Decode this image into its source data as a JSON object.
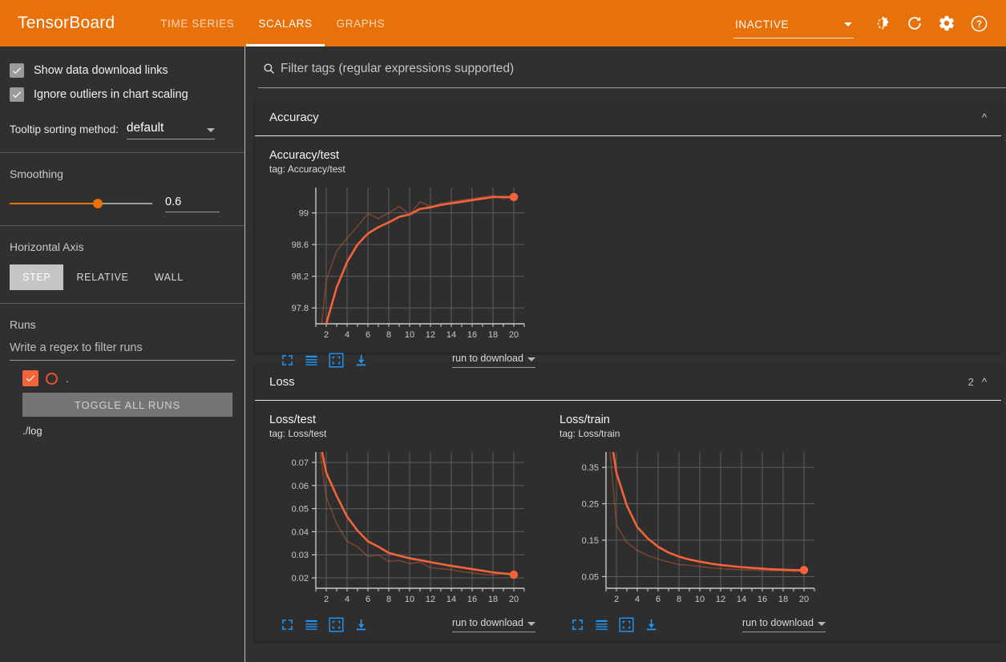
{
  "app": {
    "brand": "TensorBoard",
    "accent_orange": "#e8710a",
    "line_color": "#f4633a",
    "bg": "#303030",
    "card_bg": "#2e2e2e"
  },
  "header": {
    "tabs": [
      {
        "label": "TIME SERIES",
        "active": false
      },
      {
        "label": "SCALARS",
        "active": true
      },
      {
        "label": "GRAPHS",
        "active": false
      }
    ],
    "status": "INACTIVE",
    "icons": [
      {
        "name": "brightness-icon",
        "title": "Toggle dark mode"
      },
      {
        "name": "refresh-icon",
        "title": "Refresh"
      },
      {
        "name": "gear-icon",
        "title": "Settings"
      },
      {
        "name": "help-icon",
        "title": "Help"
      }
    ]
  },
  "sidebar": {
    "checkboxes": [
      {
        "label": "Show data download links",
        "checked": true
      },
      {
        "label": "Ignore outliers in chart scaling",
        "checked": true
      }
    ],
    "tooltip_sorting": {
      "label": "Tooltip sorting method:",
      "value": "default"
    },
    "smoothing": {
      "label": "Smoothing",
      "value": "0.6",
      "fraction": 0.62
    },
    "horizontal_axis": {
      "label": "Horizontal Axis",
      "options": [
        "STEP",
        "RELATIVE",
        "WALL"
      ],
      "selected": "STEP"
    },
    "runs": {
      "label": "Runs",
      "filter_placeholder": "Write a regex to filter runs",
      "filter_value": "",
      "items": [
        {
          "name": ".",
          "checked": true,
          "color": "#f0512c"
        }
      ],
      "toggle_all_label": "TOGGLE ALL RUNS",
      "logdir": "./log"
    }
  },
  "main": {
    "search": {
      "placeholder": "Filter tags (regular expressions supported)",
      "value": ""
    },
    "cards": [
      {
        "title": "Accuracy",
        "count": "",
        "expanded": true
      },
      {
        "title": "Loss",
        "count": "2",
        "expanded": true
      }
    ],
    "download_select_label": "run to download",
    "chart_tools": [
      {
        "name": "fit-domain-icon"
      },
      {
        "name": "toggle-y-log-icon"
      },
      {
        "name": "data-selection-icon"
      },
      {
        "name": "download-svg-icon"
      }
    ]
  },
  "chart_data": [
    {
      "id": "accuracy-test",
      "type": "line",
      "title": "Accuracy/test",
      "tag": "tag: Accuracy/test",
      "xlabel": "",
      "ylabel": "",
      "xlim": [
        1,
        21
      ],
      "ylim": [
        97.6,
        99.32
      ],
      "xticks": [
        2,
        4,
        6,
        8,
        10,
        12,
        14,
        16,
        18,
        20
      ],
      "yticks": [
        97.8,
        98.2,
        98.6,
        99
      ],
      "ytick_labels": [
        "97.8",
        "98.2",
        "98.6",
        "99"
      ],
      "grid": true,
      "legend": "none",
      "series": [
        {
          "name": "raw",
          "style": "faint",
          "x": [
            1,
            2,
            3,
            4,
            5,
            6,
            7,
            8,
            9,
            10,
            11,
            12,
            13,
            14,
            15,
            16,
            17,
            18,
            19,
            20
          ],
          "values": [
            96.9,
            98.15,
            98.52,
            98.68,
            98.83,
            98.99,
            98.93,
            99.0,
            99.08,
            98.98,
            99.14,
            99.08,
            99.12,
            99.14,
            99.16,
            99.18,
            99.2,
            99.22,
            99.18,
            99.2
          ]
        },
        {
          "name": "smoothed",
          "style": "bold",
          "x": [
            1,
            2,
            3,
            4,
            5,
            6,
            7,
            8,
            9,
            10,
            11,
            12,
            13,
            14,
            15,
            16,
            17,
            18,
            19,
            20
          ],
          "values": [
            96.9,
            97.6,
            98.06,
            98.38,
            98.6,
            98.74,
            98.82,
            98.88,
            98.95,
            98.98,
            99.05,
            99.07,
            99.1,
            99.12,
            99.14,
            99.16,
            99.18,
            99.2,
            99.2,
            99.2
          ]
        }
      ],
      "marker": {
        "x": 20,
        "y": 99.2
      }
    },
    {
      "id": "loss-test",
      "type": "line",
      "title": "Loss/test",
      "tag": "tag: Loss/test",
      "xlabel": "",
      "ylabel": "",
      "xlim": [
        1,
        21
      ],
      "ylim": [
        0.0155,
        0.0745
      ],
      "xticks": [
        2,
        4,
        6,
        8,
        10,
        12,
        14,
        16,
        18,
        20
      ],
      "yticks": [
        0.02,
        0.03,
        0.04,
        0.05,
        0.06,
        0.07
      ],
      "ytick_labels": [
        "0.02",
        "0.03",
        "0.04",
        "0.05",
        "0.06",
        "0.07"
      ],
      "grid": true,
      "legend": "none",
      "series": [
        {
          "name": "raw",
          "style": "faint",
          "x": [
            1,
            2,
            3,
            4,
            5,
            6,
            7,
            8,
            9,
            10,
            11,
            12,
            13,
            14,
            15,
            16,
            17,
            18,
            19,
            20
          ],
          "values": [
            0.088,
            0.055,
            0.0435,
            0.0358,
            0.0335,
            0.0292,
            0.0299,
            0.0272,
            0.0275,
            0.0262,
            0.0268,
            0.0244,
            0.024,
            0.0235,
            0.0227,
            0.0222,
            0.0215,
            0.0213,
            0.0218,
            0.0214
          ]
        },
        {
          "name": "smoothed",
          "style": "bold",
          "x": [
            1,
            2,
            3,
            4,
            5,
            6,
            7,
            8,
            9,
            10,
            11,
            12,
            13,
            14,
            15,
            16,
            17,
            18,
            19,
            20
          ],
          "values": [
            0.088,
            0.0655,
            0.0555,
            0.0465,
            0.0405,
            0.0358,
            0.0335,
            0.0308,
            0.0296,
            0.0285,
            0.0277,
            0.0268,
            0.026,
            0.0252,
            0.0245,
            0.0238,
            0.0231,
            0.0224,
            0.0219,
            0.0215
          ]
        }
      ],
      "marker": {
        "x": 20,
        "y": 0.0214
      }
    },
    {
      "id": "loss-train",
      "type": "line",
      "title": "Loss/train",
      "tag": "tag: Loss/train",
      "xlabel": "",
      "ylabel": "",
      "xlim": [
        1,
        21
      ],
      "ylim": [
        0.018,
        0.392
      ],
      "xticks": [
        2,
        4,
        6,
        8,
        10,
        12,
        14,
        16,
        18,
        20
      ],
      "yticks": [
        0.05,
        0.15,
        0.25,
        0.35
      ],
      "ytick_labels": [
        "0.05",
        "0.15",
        "0.25",
        "0.35"
      ],
      "grid": true,
      "legend": "none",
      "series": [
        {
          "name": "raw",
          "style": "faint",
          "x": [
            1,
            2,
            3,
            4,
            5,
            6,
            7,
            8,
            9,
            10,
            11,
            12,
            13,
            14,
            15,
            16,
            17,
            18,
            19,
            20
          ],
          "values": [
            0.52,
            0.192,
            0.144,
            0.122,
            0.108,
            0.098,
            0.09,
            0.083,
            0.081,
            0.078,
            0.074,
            0.072,
            0.07,
            0.069,
            0.068,
            0.067,
            0.066,
            0.066,
            0.065,
            0.065
          ]
        },
        {
          "name": "smoothed",
          "style": "bold",
          "x": [
            1,
            2,
            3,
            4,
            5,
            6,
            7,
            8,
            9,
            10,
            11,
            12,
            13,
            14,
            15,
            16,
            17,
            18,
            19,
            20
          ],
          "values": [
            0.52,
            0.335,
            0.245,
            0.186,
            0.155,
            0.132,
            0.116,
            0.105,
            0.097,
            0.091,
            0.086,
            0.082,
            0.079,
            0.076,
            0.074,
            0.072,
            0.07,
            0.069,
            0.068,
            0.068
          ]
        }
      ],
      "marker": {
        "x": 20,
        "y": 0.068
      }
    }
  ]
}
